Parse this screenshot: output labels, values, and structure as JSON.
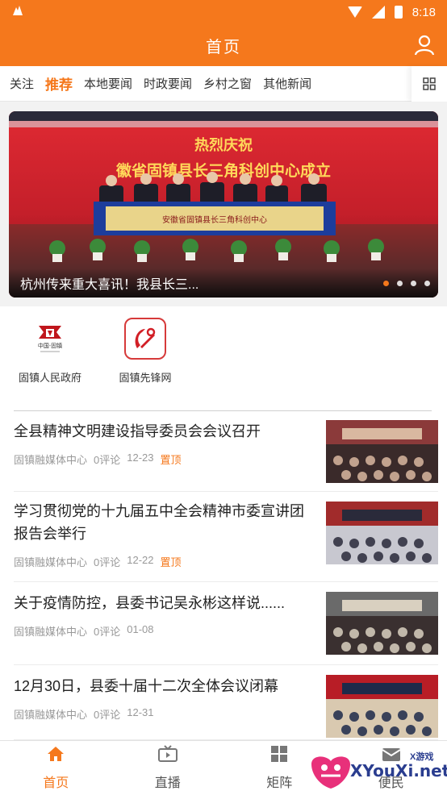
{
  "status_bar": {
    "time": "8:18"
  },
  "app_bar": {
    "title": "首页",
    "user_icon": "user-icon"
  },
  "tabs": [
    {
      "label": "关注",
      "active": false
    },
    {
      "label": "推荐",
      "active": true
    },
    {
      "label": "本地要闻",
      "active": false
    },
    {
      "label": "时政要闻",
      "active": false
    },
    {
      "label": "乡村之窗",
      "active": false
    },
    {
      "label": "其他新闻",
      "active": false
    }
  ],
  "banner": {
    "caption": "杭州传来重大喜讯！我县长三...",
    "image_heading": "热烈庆祝",
    "image_subheading": "徽省固镇县长三角科创中心成立",
    "image_plaque": "安徽省固镇县长三角科创中心",
    "dot_count": 4,
    "active_dot": 0
  },
  "quick_links": [
    {
      "label": "固镇人民政府",
      "icon": "government-emblem-icon",
      "logo_text": "中国·固镇"
    },
    {
      "label": "固镇先锋网",
      "icon": "party-flag-icon"
    }
  ],
  "news": [
    {
      "title": "全县精神文明建设指导委员会会议召开",
      "source": "固镇融媒体中心",
      "comments": "0评论",
      "date": "12-23",
      "pinned": "置顶"
    },
    {
      "title": "学习贯彻党的十九届五中全会精神市委宣讲团报告会举行",
      "source": "固镇融媒体中心",
      "comments": "0评论",
      "date": "12-22",
      "pinned": "置顶"
    },
    {
      "title": "关于疫情防控，县委书记吴永彬这样说......",
      "source": "固镇融媒体中心",
      "comments": "0评论",
      "date": "01-08",
      "pinned": ""
    },
    {
      "title": "12月30日，县委十届十二次全体会议闭幕",
      "source": "固镇融媒体中心",
      "comments": "0评论",
      "date": "12-31",
      "pinned": ""
    }
  ],
  "bottom_nav": [
    {
      "label": "首页",
      "icon": "home-icon",
      "active": true
    },
    {
      "label": "直播",
      "icon": "tv-icon",
      "active": false
    },
    {
      "label": "矩阵",
      "icon": "matrix-icon",
      "active": false
    },
    {
      "label": "便民",
      "icon": "service-icon",
      "active": false
    }
  ],
  "watermark": {
    "text": "XYouXi.net",
    "small": "X游戏"
  },
  "colors": {
    "accent": "#f5781c",
    "banner_red": "#b81d26"
  }
}
